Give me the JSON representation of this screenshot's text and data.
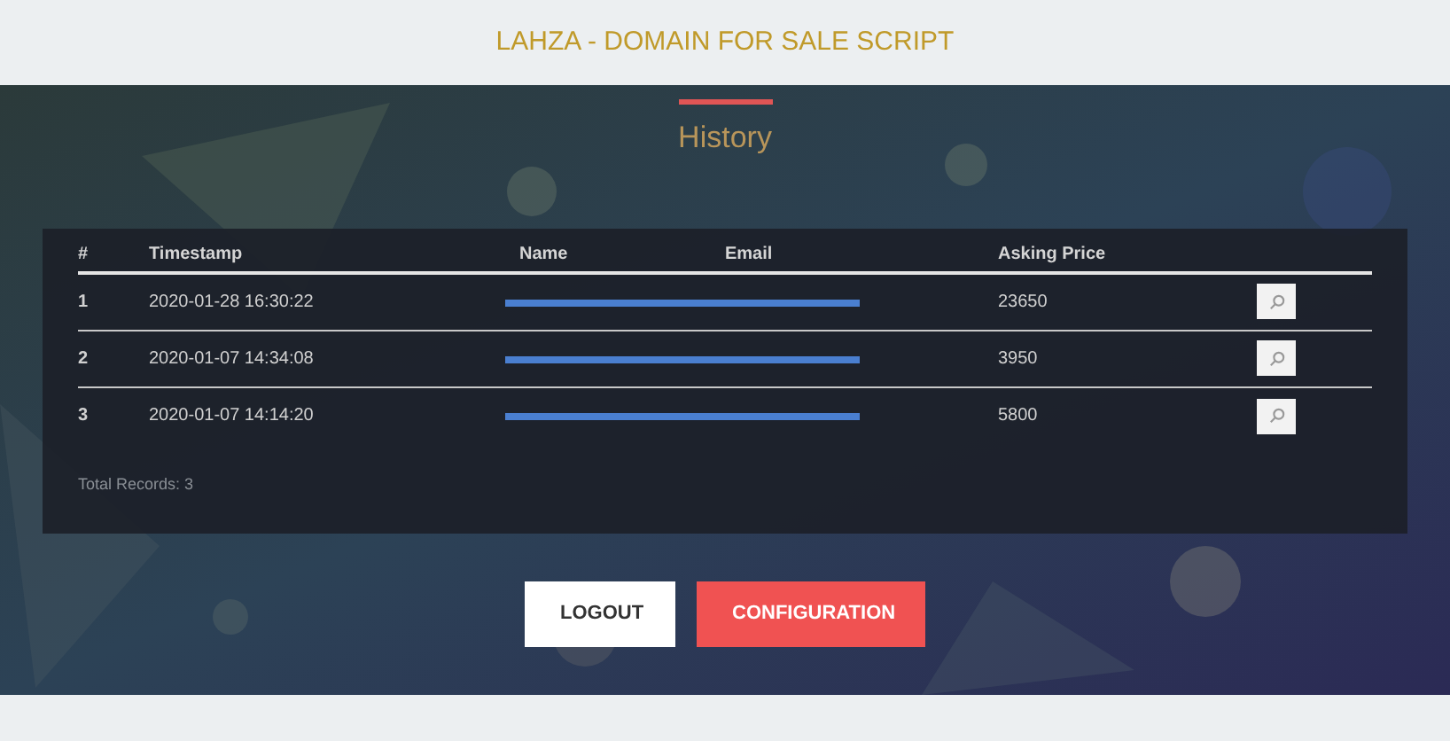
{
  "header": {
    "title": "LAHZA - DOMAIN FOR SALE SCRIPT"
  },
  "section_title": "History",
  "table": {
    "columns": [
      "#",
      "Timestamp",
      "Name",
      "Email",
      "Asking Price"
    ],
    "rows": [
      {
        "number": "1",
        "timestamp": "2020-01-28 16:30:22",
        "redacted": true,
        "asking_price": "23650"
      },
      {
        "number": "2",
        "timestamp": "2020-01-07 14:34:08",
        "redacted": true,
        "asking_price": "3950"
      },
      {
        "number": "3",
        "timestamp": "2020-01-07 14:14:20",
        "redacted": true,
        "asking_price": "5800"
      }
    ],
    "total": "Total Records: 3"
  },
  "buttons": [
    {
      "label": "LOGOUT",
      "kind": "secondary"
    },
    {
      "label": "CONFIGURATION",
      "kind": "primary"
    }
  ]
}
